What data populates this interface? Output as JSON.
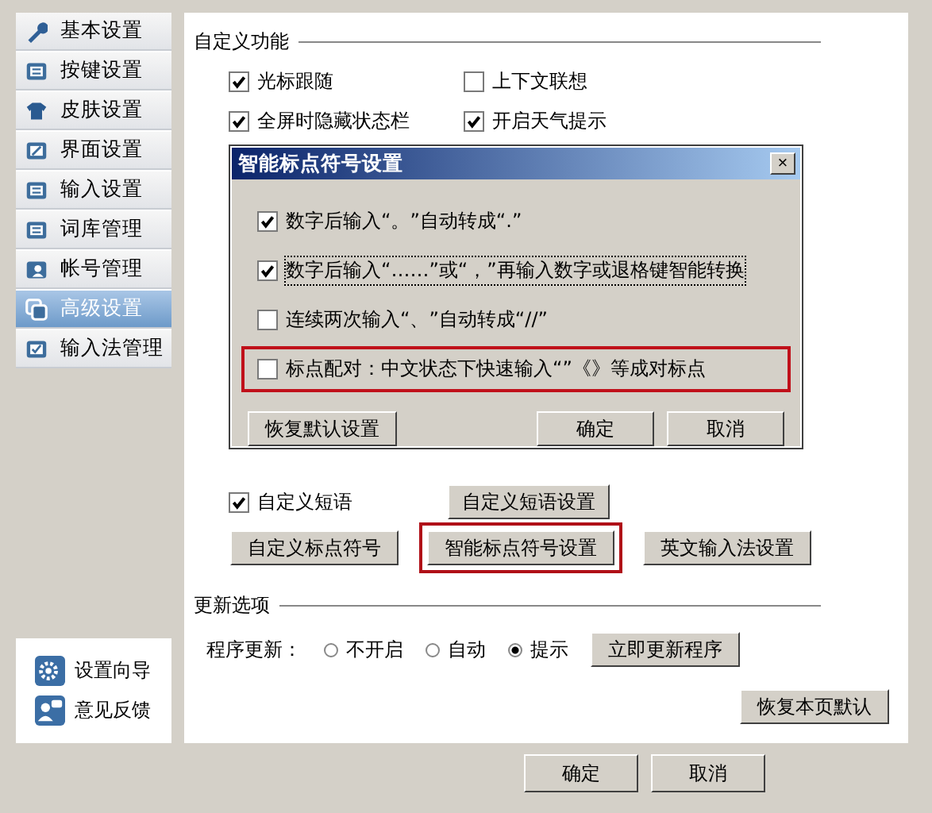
{
  "sidebar": {
    "items": [
      {
        "label": "基本设置",
        "selected": false
      },
      {
        "label": "按键设置",
        "selected": false
      },
      {
        "label": "皮肤设置",
        "selected": false
      },
      {
        "label": "界面设置",
        "selected": false
      },
      {
        "label": "输入设置",
        "selected": false
      },
      {
        "label": "词库管理",
        "selected": false
      },
      {
        "label": "帐号管理",
        "selected": false
      },
      {
        "label": "高级设置",
        "selected": true
      },
      {
        "label": "输入法管理",
        "selected": false
      }
    ],
    "links": [
      {
        "label": "设置向导"
      },
      {
        "label": "意见反馈"
      }
    ]
  },
  "custom_functions": {
    "title": "自定义功能",
    "options": [
      {
        "label": "光标跟随",
        "checked": true
      },
      {
        "label": "上下文联想",
        "checked": false
      },
      {
        "label": "全屏时隐藏状态栏",
        "checked": true
      },
      {
        "label": "开启天气提示",
        "checked": true
      }
    ]
  },
  "custom_phrase": {
    "label": "自定义短语",
    "checked": true,
    "button": "自定义短语设置"
  },
  "action_buttons": [
    {
      "label": "自定义标点符号",
      "highlighted": false
    },
    {
      "label": "智能标点符号设置",
      "highlighted": true
    },
    {
      "label": "英文输入法设置",
      "highlighted": false
    }
  ],
  "update": {
    "title": "更新选项",
    "label": "程序更新：",
    "options": [
      {
        "label": "不开启",
        "selected": false
      },
      {
        "label": "自动",
        "selected": false
      },
      {
        "label": "提示",
        "selected": true
      }
    ],
    "button": "立即更新程序"
  },
  "restore_button": "恢复本页默认",
  "footer_buttons": [
    "确定",
    "取消"
  ],
  "dialog": {
    "title": "智能标点符号设置",
    "close": "×",
    "options": [
      {
        "label": "数字后输入“。”自动转成“.”",
        "checked": true,
        "focused": false,
        "highlighted": false
      },
      {
        "label": "数字后输入“……”或“，”再输入数字或退格键智能转换",
        "checked": true,
        "focused": true,
        "highlighted": false
      },
      {
        "label": "连续两次输入“、”自动转成“//”",
        "checked": false,
        "focused": false,
        "highlighted": false
      },
      {
        "label": "标点配对：中文状态下快速输入“”《》等成对标点",
        "checked": false,
        "focused": false,
        "highlighted": true
      }
    ],
    "buttons": [
      "恢复默认设置",
      "确定",
      "取消"
    ]
  }
}
